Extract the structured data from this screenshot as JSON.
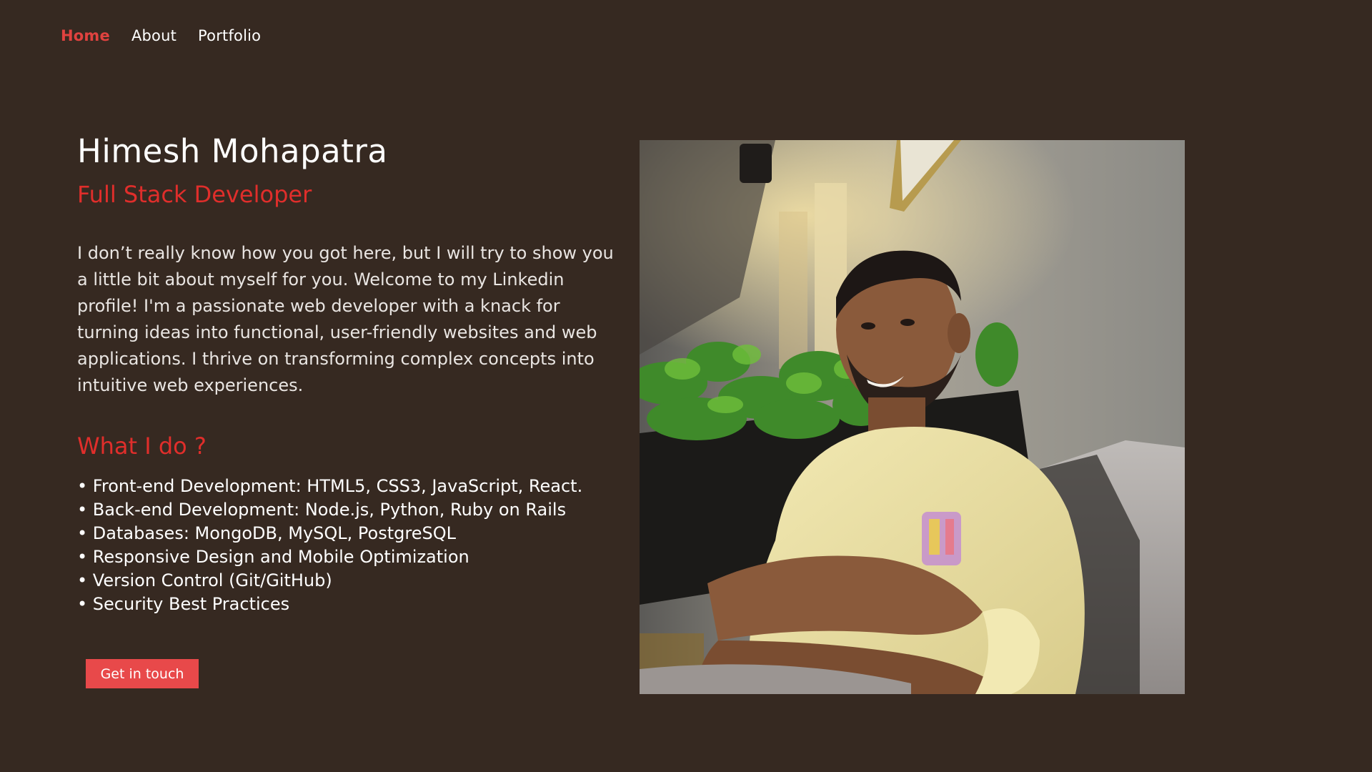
{
  "nav": {
    "items": [
      {
        "label": "Home",
        "active": true
      },
      {
        "label": "About",
        "active": false
      },
      {
        "label": "Portfolio",
        "active": false
      }
    ]
  },
  "intro": {
    "name": "Himesh Mohapatra",
    "role": "Full Stack Developer",
    "bio": "I don’t really know how you got here, but I will try to show you a little bit about myself for you. Welcome to my Linkedin profile! I'm a passionate web developer with a knack for turning ideas into functional, user-friendly websites and web applications. I thrive on transforming complex concepts into intuitive web experiences."
  },
  "what_i_do": {
    "title": "What I do ?",
    "items": [
      "Front-end Development: HTML5, CSS3, JavaScript, React.",
      "Back-end Development: Node.js, Python, Ruby on Rails",
      "Databases: MongoDB, MySQL, PostgreSQL",
      "Responsive Design and Mobile Optimization",
      "Version Control (Git/GitHub)",
      "Security Best Practices"
    ]
  },
  "cta": {
    "label": "Get in touch"
  },
  "colors": {
    "background": "#362921",
    "accent": "#e02e2b",
    "button": "#e8494a",
    "text": "#ffffff"
  }
}
